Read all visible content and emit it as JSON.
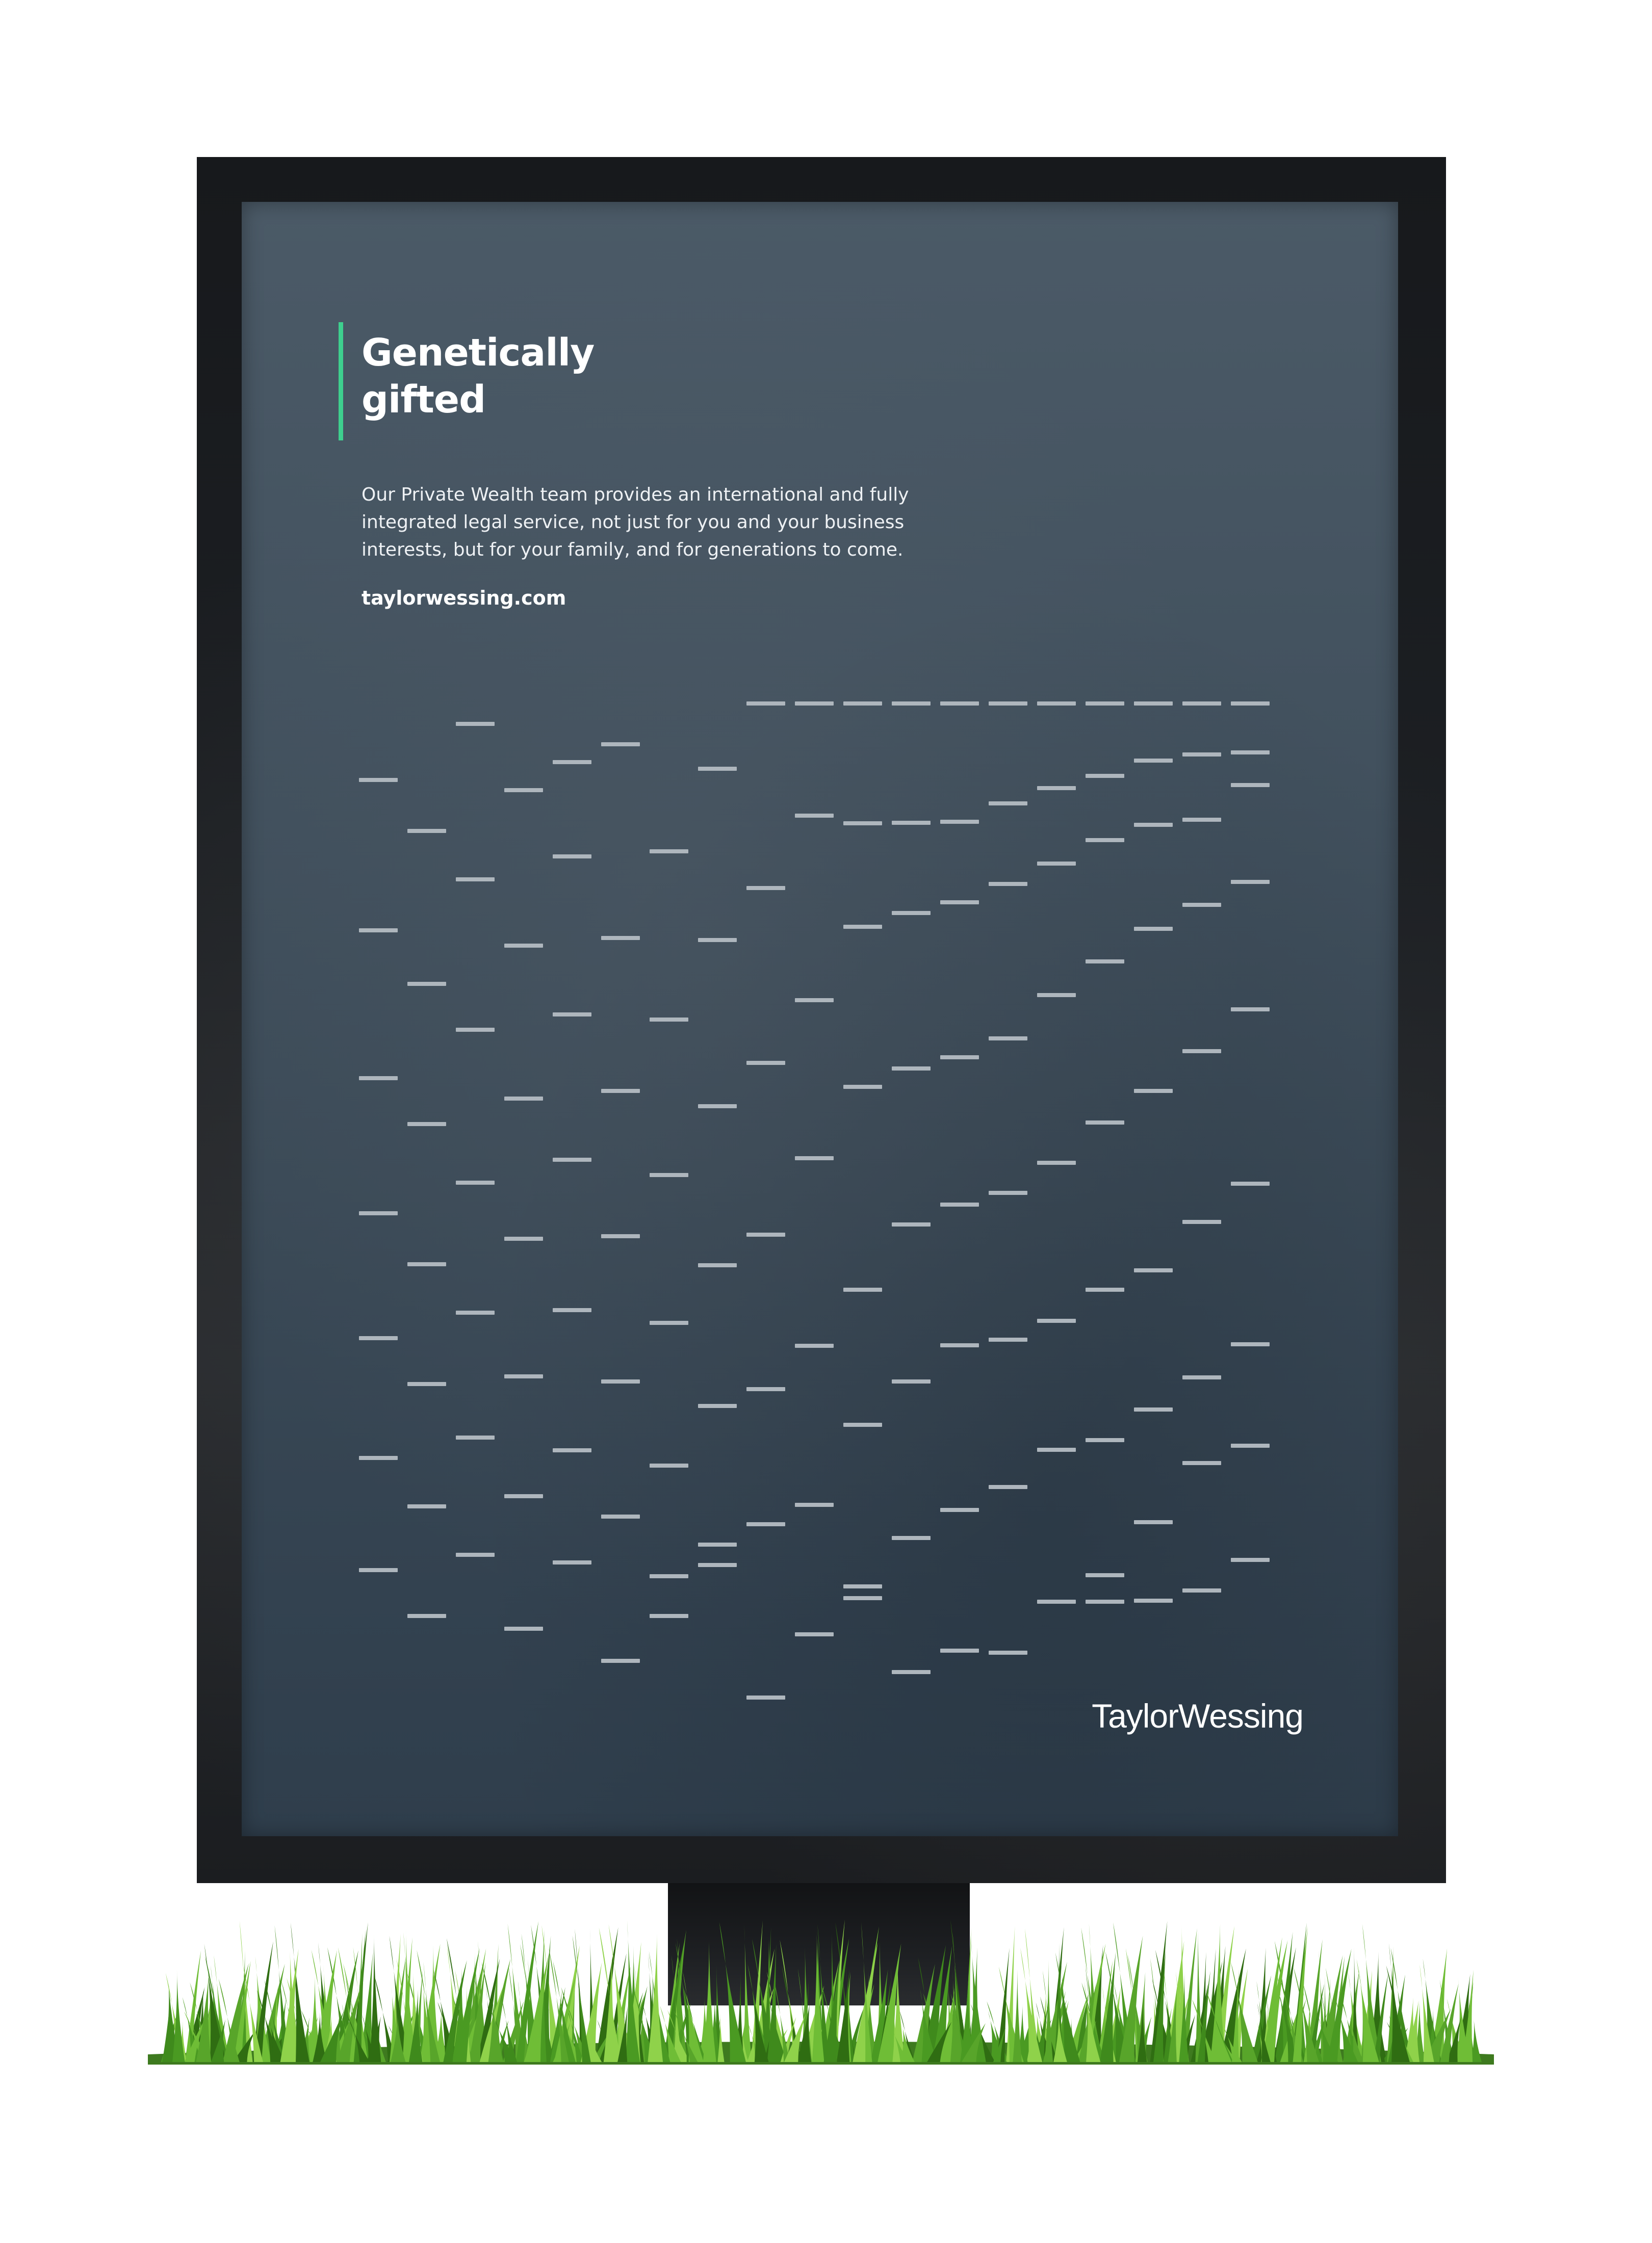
{
  "poster": {
    "headline": [
      "Genetically",
      "gifted"
    ],
    "body": [
      "Our Private Wealth team provides an international and fully",
      "integrated legal service, not just for you and your business",
      "interests, but for your family, and for generations to come."
    ],
    "url": "taylorwessing.com",
    "logo": "TaylorWessing",
    "colors": {
      "panel": "#43525f",
      "accent": "#3ecf8e",
      "dash": "#aeb6bd",
      "text": "#ffffff"
    }
  }
}
